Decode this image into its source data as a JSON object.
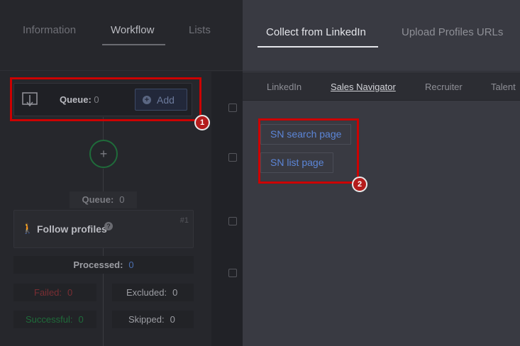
{
  "workflow": {
    "tabs": [
      {
        "label": "Information"
      },
      {
        "label": "Workflow"
      },
      {
        "label": "Lists"
      }
    ],
    "queue": {
      "label": "Queue:",
      "count": "0",
      "add_label": "Add",
      "add_icon": "plus-circle-icon",
      "icon": "download-icon"
    },
    "add_step_icon": "plus-icon",
    "step_queue": {
      "label": "Queue:",
      "count": "0"
    },
    "step": {
      "title": "Follow profiles",
      "number": "#1",
      "icon": "walking-person-icon",
      "help_icon": "question-icon"
    },
    "processed": {
      "label": "Processed:",
      "count": "0"
    },
    "failed": {
      "label": "Failed:",
      "count": "0"
    },
    "excluded": {
      "label": "Excluded:",
      "count": "0"
    },
    "successful": {
      "label": "Successful:",
      "count": "0"
    },
    "skipped": {
      "label": "Skipped:",
      "count": "0"
    }
  },
  "panel": {
    "tabs": [
      {
        "label": "Collect from LinkedIn"
      },
      {
        "label": "Upload Profiles URLs"
      }
    ],
    "subtabs": [
      {
        "label": "LinkedIn"
      },
      {
        "label": "Sales Navigator"
      },
      {
        "label": "Recruiter"
      },
      {
        "label": "Talent"
      }
    ],
    "buttons": [
      {
        "label": "SN search page"
      },
      {
        "label": "SN list page"
      }
    ]
  },
  "annotations": [
    {
      "label": "1"
    },
    {
      "label": "2"
    }
  ],
  "colors": {
    "annotation": "#cc0000",
    "link_blue": "#5c86d8",
    "success_green": "#1f6b3a",
    "failed_red": "#7a2e33"
  }
}
